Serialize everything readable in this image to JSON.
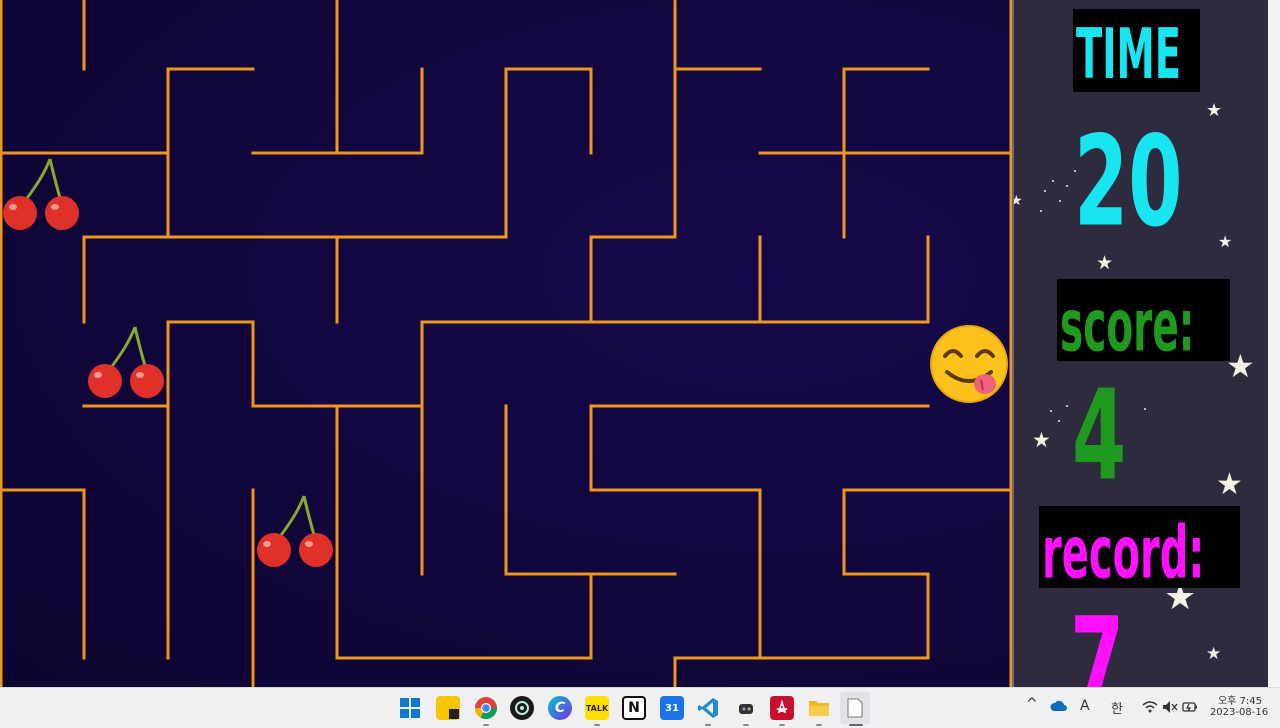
{
  "game": {
    "time_label": "TIME",
    "time_value": "20",
    "score_label": "score:",
    "score_value": "4",
    "record_label": "record:",
    "record_value": "7",
    "colors": {
      "wall": "#f0961e",
      "time": "#17e6f0",
      "score": "#1f9a1f",
      "record": "#ff10ff",
      "maze_bg": "#12073e"
    },
    "items": [
      "cherry-icon",
      "cherry-icon",
      "cherry-icon"
    ],
    "player": "face-savoring-food-icon"
  },
  "taskbar": {
    "apps": [
      "windows-start-icon",
      "sticky-notes-icon",
      "chrome-icon",
      "chatgpt-icon",
      "canva-icon",
      "kakaotalk-icon",
      "notion-icon",
      "calendar-icon",
      "vscode-icon",
      "game-app-icon",
      "acrobat-icon",
      "file-explorer-icon",
      "notepad-icon"
    ],
    "kakao_text": "TALK",
    "notion_text": "N",
    "calendar_text": "31",
    "ime_a": "A",
    "ime_lang": "한",
    "clock_time": "오후 7:45",
    "clock_date": "2023-08-16"
  }
}
